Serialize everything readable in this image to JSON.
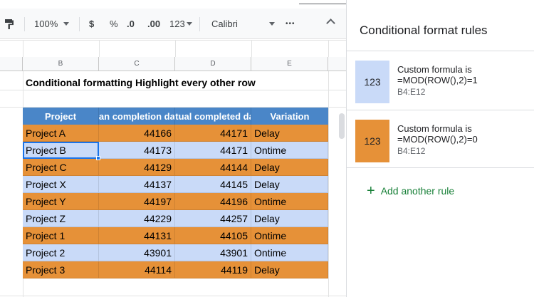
{
  "toolbar": {
    "zoom": "100%",
    "currency": "$",
    "percent": "%",
    "decrease_decimals": ".0",
    "increase_decimals": ".00",
    "more_formats": "123",
    "font": "Calibri",
    "more": "•••"
  },
  "sheet": {
    "columns": [
      "B",
      "C",
      "D",
      "E"
    ],
    "title": "Conditional formatting Highlight every other row",
    "headers": [
      "Project",
      "Plan completion date",
      "Actual completed date",
      "Variation"
    ],
    "rows": [
      [
        "Project A",
        "44166",
        "44171",
        "Delay"
      ],
      [
        "Project B",
        "44173",
        "44171",
        "Ontime"
      ],
      [
        "Project C",
        "44129",
        "44144",
        "Delay"
      ],
      [
        "Project X",
        "44137",
        "44145",
        "Delay"
      ],
      [
        "Project Y",
        "44197",
        "44196",
        "Ontime"
      ],
      [
        "Project Z",
        "44229",
        "44257",
        "Delay"
      ],
      [
        "Project 1",
        "44131",
        "44105",
        "Ontime"
      ],
      [
        "Project 2",
        "43901",
        "43901",
        "Ontime"
      ],
      [
        "Project 3",
        "44114",
        "44119",
        "Delay"
      ]
    ],
    "colors": {
      "orange": "#e69138",
      "blue": "#c9daf8",
      "header": "#4a86c8"
    }
  },
  "panel": {
    "title": "Conditional format rules",
    "rules": [
      {
        "swatch": "123",
        "color": "#c9daf8",
        "line1": "Custom formula is",
        "line2": "=MOD(ROW(),2)=1",
        "range": "B4:E12"
      },
      {
        "swatch": "123",
        "color": "#e69138",
        "line1": "Custom formula is",
        "line2": "=MOD(ROW(),2)=0",
        "range": "B4:E12"
      }
    ],
    "add_label": "Add another rule"
  }
}
